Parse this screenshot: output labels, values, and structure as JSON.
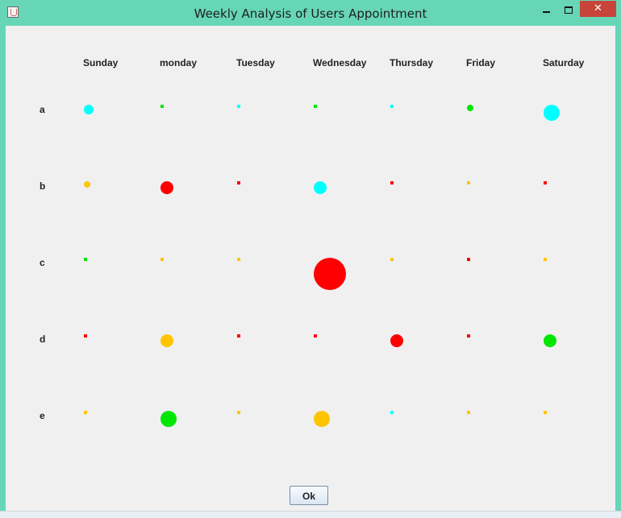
{
  "window": {
    "title": "Weekly Analysis of Users Appointment",
    "close_label": "✕"
  },
  "ok_button": {
    "label": "Ok"
  },
  "colors": {
    "red": "#ff0000",
    "orange": "#ffc400",
    "green": "#00e600",
    "cyan": "#00ffff"
  },
  "chart_data": {
    "type": "scatter",
    "title": "",
    "xlabel": "",
    "ylabel": "",
    "days": [
      "Sunday",
      "monday",
      "Tuesday",
      "Wednesday",
      "Thursday",
      "Friday",
      "Saturday"
    ],
    "rows": [
      "a",
      "b",
      "c",
      "d",
      "e"
    ],
    "grid": false,
    "legend": "none",
    "points": [
      {
        "row": "a",
        "day": "Sunday",
        "color": "cyan",
        "size": 3
      },
      {
        "row": "a",
        "day": "monday",
        "color": "green",
        "size": 1
      },
      {
        "row": "a",
        "day": "Tuesday",
        "color": "cyan",
        "size": 1
      },
      {
        "row": "a",
        "day": "Wednesday",
        "color": "green",
        "size": 1
      },
      {
        "row": "a",
        "day": "Thursday",
        "color": "cyan",
        "size": 1
      },
      {
        "row": "a",
        "day": "Friday",
        "color": "green",
        "size": 2
      },
      {
        "row": "a",
        "day": "Saturday",
        "color": "cyan",
        "size": 5
      },
      {
        "row": "b",
        "day": "Sunday",
        "color": "orange",
        "size": 2
      },
      {
        "row": "b",
        "day": "monday",
        "color": "red",
        "size": 4
      },
      {
        "row": "b",
        "day": "Tuesday",
        "color": "red",
        "size": 1
      },
      {
        "row": "b",
        "day": "Wednesday",
        "color": "cyan",
        "size": 4
      },
      {
        "row": "b",
        "day": "Thursday",
        "color": "red",
        "size": 1
      },
      {
        "row": "b",
        "day": "Friday",
        "color": "orange",
        "size": 1
      },
      {
        "row": "b",
        "day": "Saturday",
        "color": "red",
        "size": 1
      },
      {
        "row": "c",
        "day": "Sunday",
        "color": "green",
        "size": 1
      },
      {
        "row": "c",
        "day": "monday",
        "color": "orange",
        "size": 1
      },
      {
        "row": "c",
        "day": "Tuesday",
        "color": "orange",
        "size": 1
      },
      {
        "row": "c",
        "day": "Wednesday",
        "color": "red",
        "size": 10
      },
      {
        "row": "c",
        "day": "Thursday",
        "color": "orange",
        "size": 1
      },
      {
        "row": "c",
        "day": "Friday",
        "color": "red",
        "size": 1
      },
      {
        "row": "c",
        "day": "Saturday",
        "color": "orange",
        "size": 1
      },
      {
        "row": "d",
        "day": "Sunday",
        "color": "red",
        "size": 1
      },
      {
        "row": "d",
        "day": "monday",
        "color": "orange",
        "size": 4
      },
      {
        "row": "d",
        "day": "Tuesday",
        "color": "red",
        "size": 1
      },
      {
        "row": "d",
        "day": "Wednesday",
        "color": "red",
        "size": 1
      },
      {
        "row": "d",
        "day": "Thursday",
        "color": "red",
        "size": 4
      },
      {
        "row": "d",
        "day": "Friday",
        "color": "red",
        "size": 1
      },
      {
        "row": "d",
        "day": "Saturday",
        "color": "green",
        "size": 4
      },
      {
        "row": "e",
        "day": "Sunday",
        "color": "orange",
        "size": 1
      },
      {
        "row": "e",
        "day": "monday",
        "color": "green",
        "size": 5
      },
      {
        "row": "e",
        "day": "Tuesday",
        "color": "orange",
        "size": 1
      },
      {
        "row": "e",
        "day": "Wednesday",
        "color": "orange",
        "size": 5
      },
      {
        "row": "e",
        "day": "Thursday",
        "color": "cyan",
        "size": 1
      },
      {
        "row": "e",
        "day": "Friday",
        "color": "orange",
        "size": 1
      },
      {
        "row": "e",
        "day": "Saturday",
        "color": "orange",
        "size": 1
      }
    ]
  }
}
